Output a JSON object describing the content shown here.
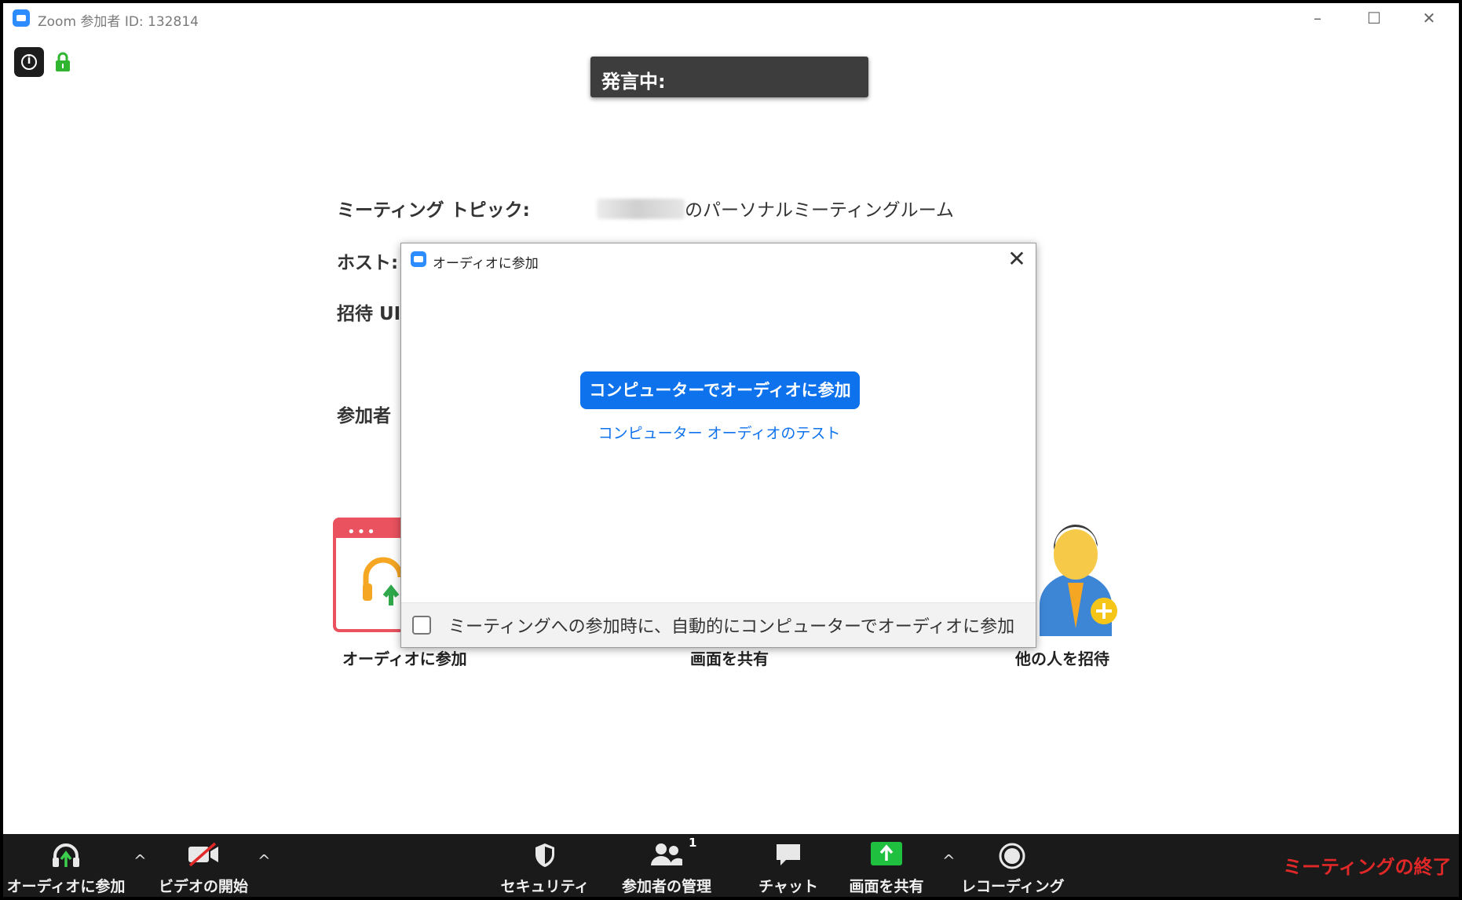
{
  "window": {
    "title": "Zoom 参加者 ID: 132814",
    "controls": {
      "minimize": "–",
      "maximize": "☐",
      "close": "✕"
    }
  },
  "top_icons": {
    "info": "i",
    "lock": "lock-icon"
  },
  "speaking_bar": {
    "label": "発言中:"
  },
  "meeting_info": {
    "topic_label": "ミーティング トピック:",
    "topic_value": "のパーソナルミーティングルーム",
    "host_label": "ホスト:",
    "invite_label": "招待 UI",
    "participant_label": "参加者"
  },
  "tiles": {
    "audio_label": "オーディオに参加",
    "share_label": "画面を共有",
    "invite_label": "他の人を招待"
  },
  "dialog": {
    "title": "オーディオに参加",
    "close": "✕",
    "join_button": "コンピューターでオーディオに参加",
    "test_link": "コンピューター オーディオのテスト",
    "auto_join_label": "ミーティングへの参加時に、自動的にコンピューターでオーディオに参加",
    "auto_join_checked": false
  },
  "toolbar": {
    "join_audio": "オーディオに参加",
    "start_video": "ビデオの開始",
    "security": "セキュリティ",
    "participants": "参加者の管理",
    "participant_count": "1",
    "chat": "チャット",
    "share_screen": "画面を共有",
    "recording": "レコーディング",
    "end_meeting": "ミーティングの終了",
    "caret": "^"
  },
  "colors": {
    "zoom_blue": "#2d8cff",
    "button_blue": "#0e72ed",
    "end_red": "#e02828",
    "share_green": "#1fbf3f",
    "toolbar_bg": "#1a1a1a"
  }
}
